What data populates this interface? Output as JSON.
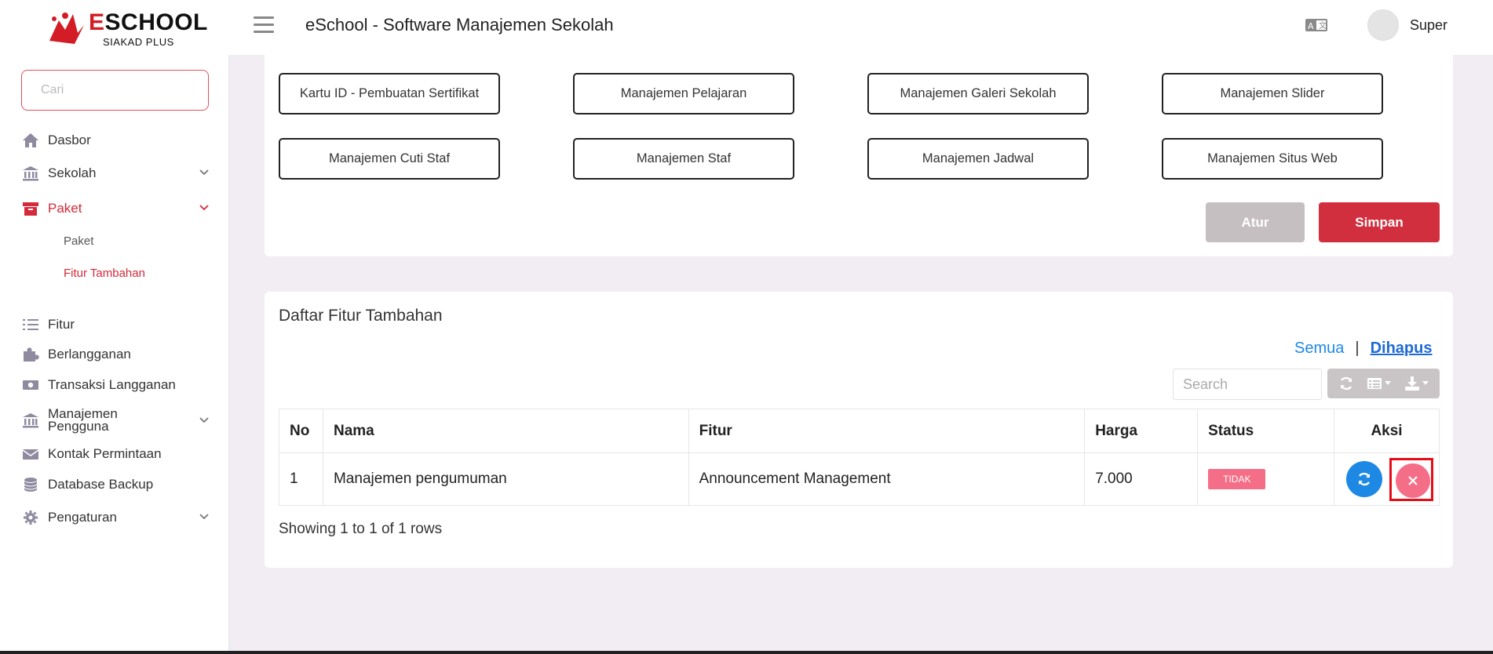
{
  "header": {
    "logo_main": "SCHOOL",
    "logo_initial": "E",
    "logo_sub": "SIAKAD PLUS",
    "title": "eSchool - Software Manajemen Sekolah",
    "user_name": "Super"
  },
  "sidebar": {
    "search_placeholder": "Cari",
    "items": [
      {
        "label": "Dasbor",
        "icon": "home-icon"
      },
      {
        "label": "Sekolah",
        "icon": "bank-icon"
      },
      {
        "label": "Paket",
        "icon": "archive-icon"
      },
      {
        "label": "Fitur",
        "icon": "list-icon"
      },
      {
        "label": "Berlangganan",
        "icon": "puzzle-icon"
      },
      {
        "label": "Transaksi Langganan",
        "icon": "money-icon"
      },
      {
        "label": "Manajemen Pengguna",
        "icon": "building-icon"
      },
      {
        "label": "Kontak Permintaan",
        "icon": "mail-icon"
      },
      {
        "label": "Database Backup",
        "icon": "database-icon"
      },
      {
        "label": "Pengaturan",
        "icon": "gear-icon"
      }
    ],
    "sub_items": [
      {
        "label": "Paket"
      },
      {
        "label": "Fitur Tambahan"
      }
    ],
    "active_color": "#d42a3a"
  },
  "features": {
    "buttons": [
      "Kartu ID - Pembuatan Sertifikat",
      "Manajemen Pelajaran",
      "Manajemen Galeri Sekolah",
      "Manajemen Slider",
      "Manajemen Cuti Staf",
      "Manajemen Staf",
      "Manajemen Jadwal",
      "Manajemen Situs Web"
    ],
    "atur_label": "Atur",
    "simpan_label": "Simpan"
  },
  "list": {
    "title": "Daftar Fitur Tambahan",
    "filter_all": "Semua",
    "filter_sep": "|",
    "filter_deleted": "Dihapus",
    "search_placeholder": "Search",
    "columns": [
      "No",
      "Nama",
      "Fitur",
      "Harga",
      "Status",
      "Aksi"
    ],
    "rows": [
      {
        "no": "1",
        "nama": "Manajemen pengumuman",
        "fitur": "Announcement Management",
        "harga": "7.000",
        "status": "TIDAK"
      }
    ],
    "showing": "Showing 1 to 1 of 1 rows"
  },
  "colors": {
    "primary_red": "#d22f3e",
    "blue": "#1e88e5",
    "pink": "#f56e88",
    "highlight_frame": "#e60c18"
  }
}
